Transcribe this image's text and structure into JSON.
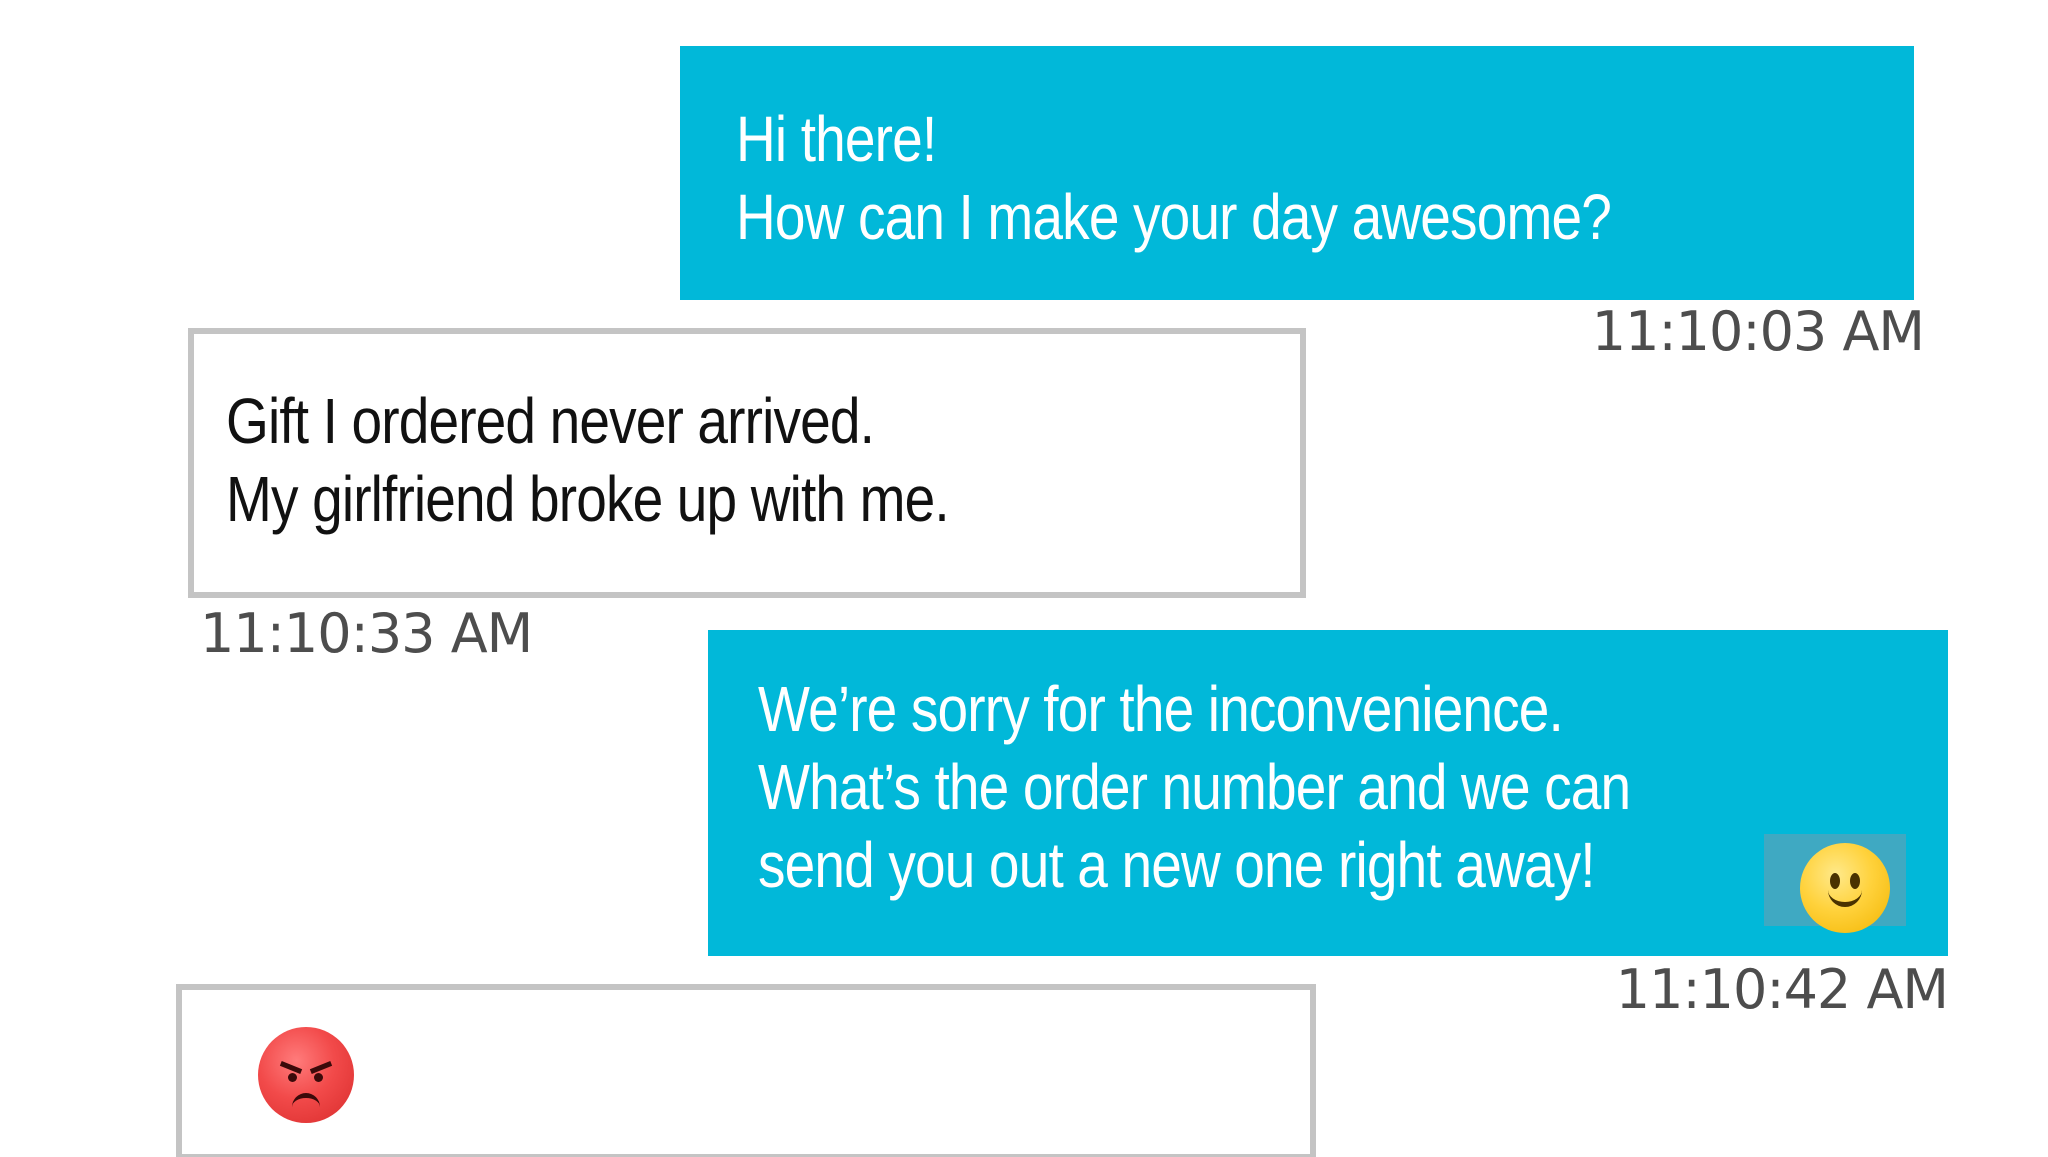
{
  "conversation": {
    "messages": [
      {
        "sender": "agent",
        "lines": [
          "Hi there!",
          "How can I make your day awesome?"
        ],
        "timestamp": "11:10:03 AM"
      },
      {
        "sender": "user",
        "lines": [
          "Gift I ordered never arrived.",
          "My girlfriend broke up with me."
        ],
        "timestamp": "11:10:33 AM"
      },
      {
        "sender": "agent",
        "lines": [
          "We’re sorry for the inconvenience.",
          "What’s the order number and we can",
          "send you out a new one right away!"
        ],
        "emoji": "slightly-smiling-face-icon",
        "timestamp": "11:10:42 AM"
      },
      {
        "sender": "user",
        "lines": [],
        "emoji": "angry-face-icon"
      }
    ]
  },
  "colors": {
    "agent_bubble": "#01b8d9",
    "user_border": "#c4c4c4",
    "timestamp": "#4d4d4d"
  }
}
